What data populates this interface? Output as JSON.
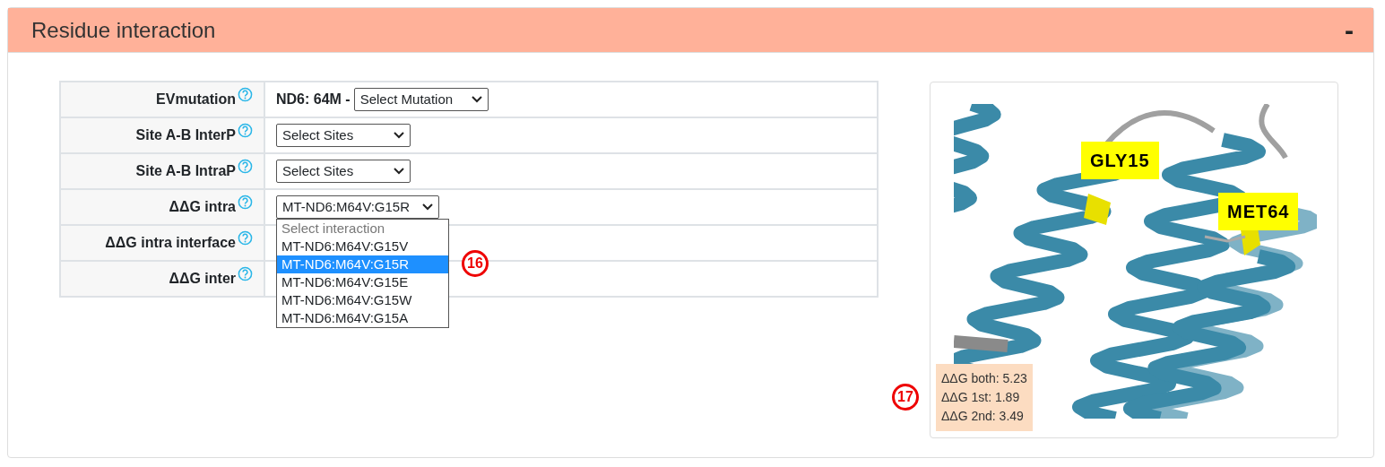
{
  "panel": {
    "title": "Residue interaction",
    "collapse_symbol": "-"
  },
  "rows": [
    {
      "label": "EVmutation",
      "kind": "mutation",
      "prefix": "ND6: 64M -",
      "select": "Select Mutation"
    },
    {
      "label": "Site A-B InterP",
      "kind": "select",
      "select": "Select Sites"
    },
    {
      "label": "Site A-B IntraP",
      "kind": "select",
      "select": "Select Sites"
    },
    {
      "label": "ΔΔG intra",
      "kind": "select",
      "select": "MT-ND6:M64V:G15R",
      "expanded": true
    },
    {
      "label": "ΔΔG intra interface",
      "kind": "empty"
    },
    {
      "label": "ΔΔG inter",
      "kind": "empty"
    }
  ],
  "dropdown": {
    "header_option": "Select interaction",
    "options": [
      {
        "label": "MT-ND6:M64V:G15V",
        "selected": false
      },
      {
        "label": "MT-ND6:M64V:G15R",
        "selected": true
      },
      {
        "label": "MT-ND6:M64V:G15E",
        "selected": false
      },
      {
        "label": "MT-ND6:M64V:G15W",
        "selected": false
      },
      {
        "label": "MT-ND6:M64V:G15A",
        "selected": false
      }
    ]
  },
  "viewer": {
    "residue_labels": [
      "GLY15",
      "MET64"
    ],
    "energies": [
      "ΔΔG both: 5.23",
      "ΔΔG 1st: 1.89",
      "ΔΔG 2nd: 3.49"
    ]
  },
  "callouts": [
    "16",
    "17"
  ]
}
